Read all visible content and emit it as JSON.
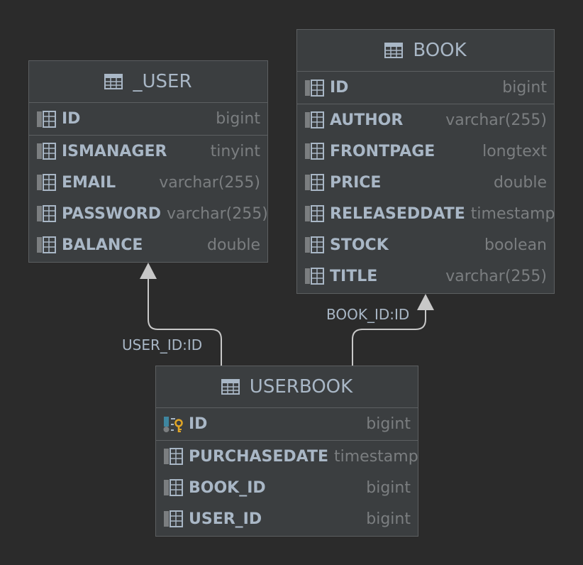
{
  "colors": {
    "background": "#2b2b2b",
    "table_bg": "#3b3e40",
    "border": "#5c5f61",
    "name_text": "#a9b7c6",
    "type_text": "#7b7e80",
    "edge": "#c8c8c8",
    "key_accent": "#e0a526",
    "pk_icon_blue": "#3e86a0"
  },
  "tables": {
    "user": {
      "title": "_USER",
      "columns": [
        {
          "name": "ID",
          "type": "bigint"
        },
        {
          "name": "ISMANAGER",
          "type": "tinyint"
        },
        {
          "name": "EMAIL",
          "type": "varchar(255)"
        },
        {
          "name": "PASSWORD",
          "type": "varchar(255)"
        },
        {
          "name": "BALANCE",
          "type": "double"
        }
      ]
    },
    "book": {
      "title": "BOOK",
      "columns": [
        {
          "name": "ID",
          "type": "bigint"
        },
        {
          "name": "AUTHOR",
          "type": "varchar(255)"
        },
        {
          "name": "FRONTPAGE",
          "type": "longtext"
        },
        {
          "name": "PRICE",
          "type": "double"
        },
        {
          "name": "RELEASEDDATE",
          "type": "timestamp"
        },
        {
          "name": "STOCK",
          "type": "boolean"
        },
        {
          "name": "TITLE",
          "type": "varchar(255)"
        }
      ]
    },
    "userbook": {
      "title": "USERBOOK",
      "columns": [
        {
          "name": "ID",
          "type": "bigint"
        },
        {
          "name": "PURCHASEDATE",
          "type": "timestamp"
        },
        {
          "name": "BOOK_ID",
          "type": "bigint"
        },
        {
          "name": "USER_ID",
          "type": "bigint"
        }
      ]
    }
  },
  "relations": [
    {
      "label": "USER_ID:ID",
      "from": "USERBOOK",
      "to": "_USER"
    },
    {
      "label": "BOOK_ID:ID",
      "from": "USERBOOK",
      "to": "BOOK"
    }
  ],
  "icons": {
    "table": "table-icon",
    "column": "column-icon",
    "primary_key_column": "primary-key-column-icon"
  }
}
